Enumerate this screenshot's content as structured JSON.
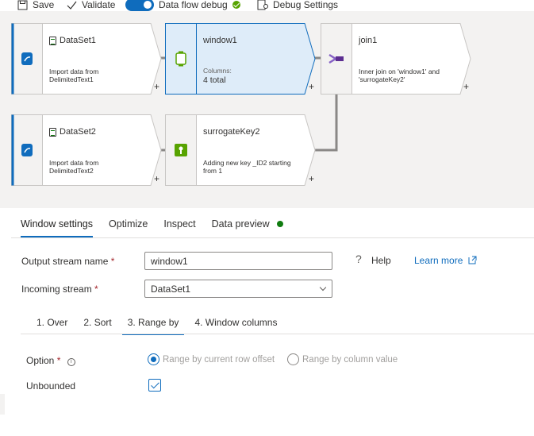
{
  "toolbar": {
    "save_label": "Save",
    "validate_label": "Validate",
    "debug_label": "Data flow debug",
    "debug_settings_label": "Debug Settings"
  },
  "canvas": {
    "nodes": {
      "dataset1": {
        "title": "DataSet1",
        "desc": "Import data from DelimitedText1"
      },
      "window1": {
        "title": "window1",
        "columns_label": "Columns:",
        "columns_value": "4 total"
      },
      "join1": {
        "title": "join1",
        "desc": "Inner join on 'window1' and 'surrogateKey2'"
      },
      "dataset2": {
        "title": "DataSet2",
        "desc": "Import data from DelimitedText2"
      },
      "surrogatekey2": {
        "title": "surrogateKey2",
        "desc": "Adding new key _ID2 starting from 1"
      }
    },
    "plus": "+"
  },
  "tabs": [
    {
      "label": "Window settings"
    },
    {
      "label": "Optimize"
    },
    {
      "label": "Inspect"
    },
    {
      "label": "Data preview"
    }
  ],
  "form": {
    "output_label": "Output stream name",
    "output_value": "window1",
    "incoming_label": "Incoming stream",
    "incoming_value": "DataSet1",
    "required": "*",
    "help_label": "Help",
    "learn_more_label": "Learn more"
  },
  "subtabs": [
    {
      "label": "1. Over"
    },
    {
      "label": "2. Sort"
    },
    {
      "label": "3. Range by"
    },
    {
      "label": "4. Window columns"
    }
  ],
  "range": {
    "option_label": "Option",
    "radio1": "Range by current row offset",
    "radio2": "Range by column value",
    "unbounded_label": "Unbounded"
  },
  "colors": {
    "accent": "#0f6cbd",
    "selected_node_fill": "#deecf9",
    "success": "#57a300"
  }
}
